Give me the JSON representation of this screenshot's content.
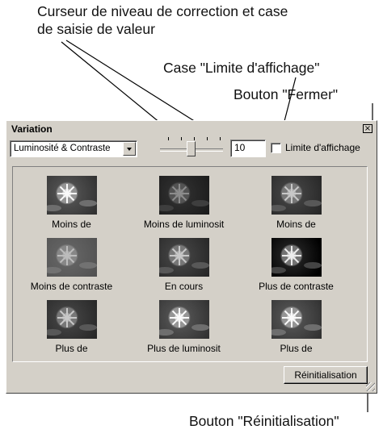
{
  "callouts": {
    "slider_line1": "Curseur de niveau de correction et case",
    "slider_line2": "de saisie de valeur",
    "limit": "Case \"Limite d'affichage\"",
    "close": "Bouton \"Fermer\"",
    "reset": "Bouton \"Réinitialisation\""
  },
  "window": {
    "title": "Variation",
    "close_glyph": "×"
  },
  "toolbar": {
    "mode_value": "Luminosité & Contraste",
    "level_value": "10",
    "limit_checked": false,
    "limit_label": "Limite d'affichage"
  },
  "variants": [
    {
      "label": "Moins de"
    },
    {
      "label": "Moins de luminosit"
    },
    {
      "label": "Moins de"
    },
    {
      "label": "Moins de contraste"
    },
    {
      "label": "En cours"
    },
    {
      "label": "Plus de contraste"
    },
    {
      "label": "Plus de"
    },
    {
      "label": "Plus de luminosit"
    },
    {
      "label": "Plus de"
    }
  ],
  "footer": {
    "reset_label": "Réinitialisation"
  }
}
